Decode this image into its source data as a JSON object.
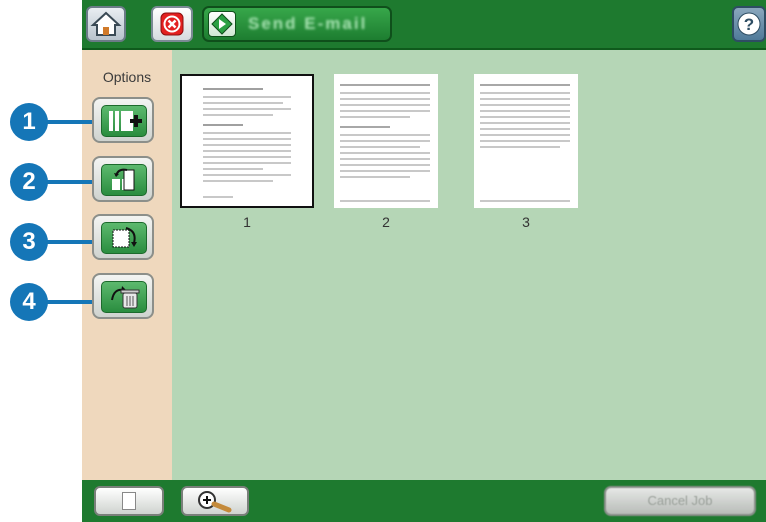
{
  "topbar": {
    "home_icon": "home-icon",
    "cancel_icon": "red-x-icon",
    "send_label": "Send E-mail",
    "send_icon": "green-diamond-start-icon",
    "help_icon": "question-mark-icon"
  },
  "sidebar": {
    "title": "Options",
    "items": [
      {
        "callout": "1",
        "icon": "add-page-icon"
      },
      {
        "callout": "2",
        "icon": "move-page-icon"
      },
      {
        "callout": "3",
        "icon": "rotate-page-icon"
      },
      {
        "callout": "4",
        "icon": "delete-page-icon"
      }
    ]
  },
  "pages": [
    {
      "number": "1",
      "selected": true
    },
    {
      "number": "2",
      "selected": false
    },
    {
      "number": "3",
      "selected": false
    }
  ],
  "bottombar": {
    "page_view_icon": "single-page-icon",
    "zoom_icon": "zoom-in-magnifier-icon",
    "cancel_job_label": "Cancel Job"
  },
  "colors": {
    "bar_green": "#1e7a2f",
    "panel_tan": "#efd8bd",
    "preview_bg": "#b5d6b6",
    "callout_blue": "#1576b7"
  }
}
